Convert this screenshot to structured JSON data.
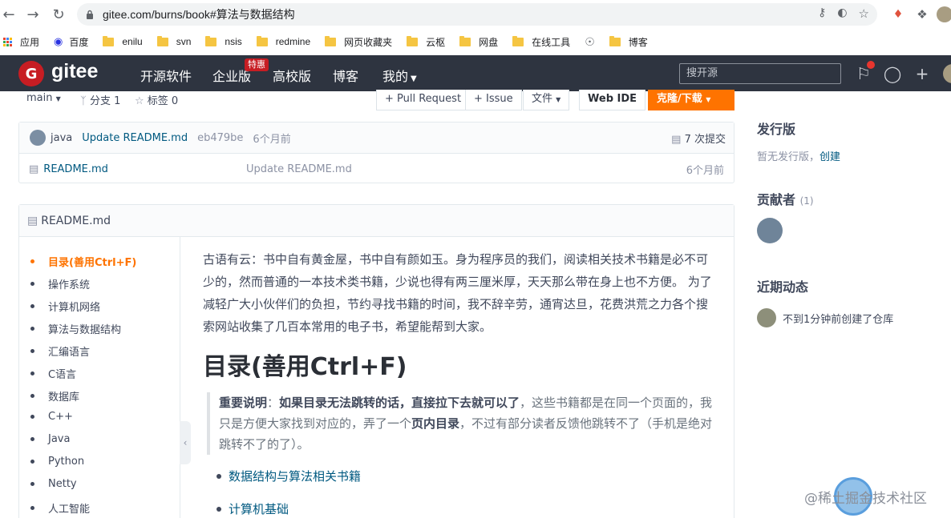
{
  "browser": {
    "url": "gitee.com/burns/book#算法与数据结构",
    "bookmarks": [
      "应用",
      "百度",
      "enilu",
      "svn",
      "nsis",
      "redmine",
      "网页收藏夹",
      "云枢",
      "网盘",
      "在线工具",
      "博客"
    ]
  },
  "header": {
    "brand": "gitee",
    "nav": [
      "开源软件",
      "企业版",
      "高校版",
      "博客",
      "我的"
    ],
    "hot_badge": "特惠",
    "search_placeholder": "搜开源"
  },
  "toolbar": {
    "branch": "main",
    "branches": "分支 1",
    "tags": "标签 0",
    "pull_request": "+ Pull Request",
    "issue": "+ Issue",
    "file": "文件",
    "web_ide": "Web IDE",
    "clone": "克隆/下载"
  },
  "commit": {
    "author": "java",
    "message": "Update README.md",
    "hash": "eb479be",
    "time": "6个月前",
    "commits": "7 次提交"
  },
  "files": [
    {
      "name": "README.md",
      "message": "Update README.md",
      "time": "6个月前"
    }
  ],
  "readme": {
    "title": "README.md",
    "toc": [
      "目录(善用Ctrl+F)",
      "操作系统",
      "计算机网络",
      "算法与数据结构",
      "汇编语言",
      "C语言",
      "数据库",
      "C++",
      "Java",
      "Python",
      "Netty",
      "人工智能"
    ],
    "intro": "古语有云：书中自有黄金屋，书中自有颜如玉。身为程序员的我们，阅读相关技术书籍是必不可少的，然而普通的一本技术类书籍，少说也得有两三厘米厚，天天那么带在身上也不方便。 为了减轻广大小伙伴们的负担，节约寻找书籍的时间，我不辞辛劳，通宵达旦，花费洪荒之力各个搜索网站收集了几百本常用的电子书，希望能帮到大家。",
    "heading": "目录(善用Ctrl+F)",
    "note_label": "重要说明",
    "note_bold": "如果目录无法跳转的话，直接拉下去就可以了",
    "note_rest1": "，这些书籍都是在同一个页面的，我只是方便大家找到对应的，弄了一个",
    "note_bold2": "页内目录",
    "note_rest2": "，不过有部分读者反馈他跳转不了（手机是绝对跳转不了的了）。",
    "links": [
      "数据结构与算法相关书籍",
      "计算机基础"
    ]
  },
  "sidebar": {
    "release_title": "发行版",
    "release_text": "暂无发行版，",
    "release_link": "创建",
    "contrib_title": "贡献者",
    "contrib_count": "(1)",
    "activity_title": "近期动态",
    "activity_text": "不到1分钟前创建了仓库"
  },
  "watermark": "@稀土掘金技术社区"
}
